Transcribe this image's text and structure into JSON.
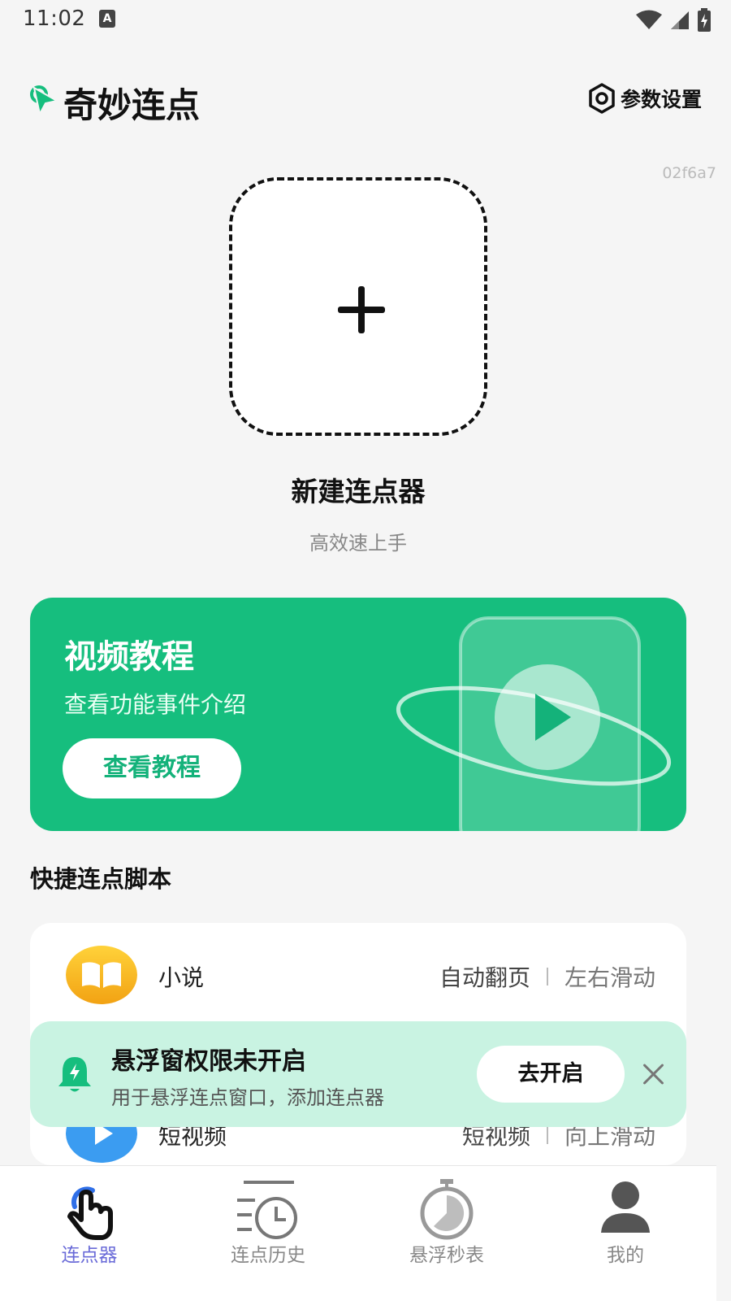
{
  "status_bar": {
    "time": "11:02",
    "notification_glyph": "A"
  },
  "header": {
    "app_title": "奇妙连点",
    "settings_label": "参数设置",
    "build_id": "02f6a7"
  },
  "new_clicker": {
    "title": "新建连点器",
    "subtitle": "高效速上手"
  },
  "tutorial": {
    "title": "视频教程",
    "subtitle": "查看功能事件介绍",
    "button_label": "查看教程"
  },
  "quick_scripts": {
    "section_title": "快捷连点脚本",
    "items": [
      {
        "name": "小说",
        "tag1": "自动翻页",
        "tag2": "左右滑动",
        "icon": "book-icon"
      },
      {
        "name": "短视频",
        "tag1": "短视频",
        "tag2": "向上滑动",
        "icon": "video-icon"
      }
    ]
  },
  "permission_toast": {
    "title": "悬浮窗权限未开启",
    "subtitle": "用于悬浮连点窗口，添加连点器",
    "button_label": "去开启"
  },
  "bottom_nav": [
    {
      "label": "连点器",
      "icon": "tap-hand-icon",
      "active": true
    },
    {
      "label": "连点历史",
      "icon": "history-clock-icon",
      "active": false
    },
    {
      "label": "悬浮秒表",
      "icon": "stopwatch-icon",
      "active": false
    },
    {
      "label": "我的",
      "icon": "user-icon",
      "active": false
    }
  ],
  "colors": {
    "brand_green": "#16be7e",
    "toast_bg": "#c9f3e2",
    "active_nav": "#6a6bd8",
    "page_bg": "#f5f5f5"
  }
}
